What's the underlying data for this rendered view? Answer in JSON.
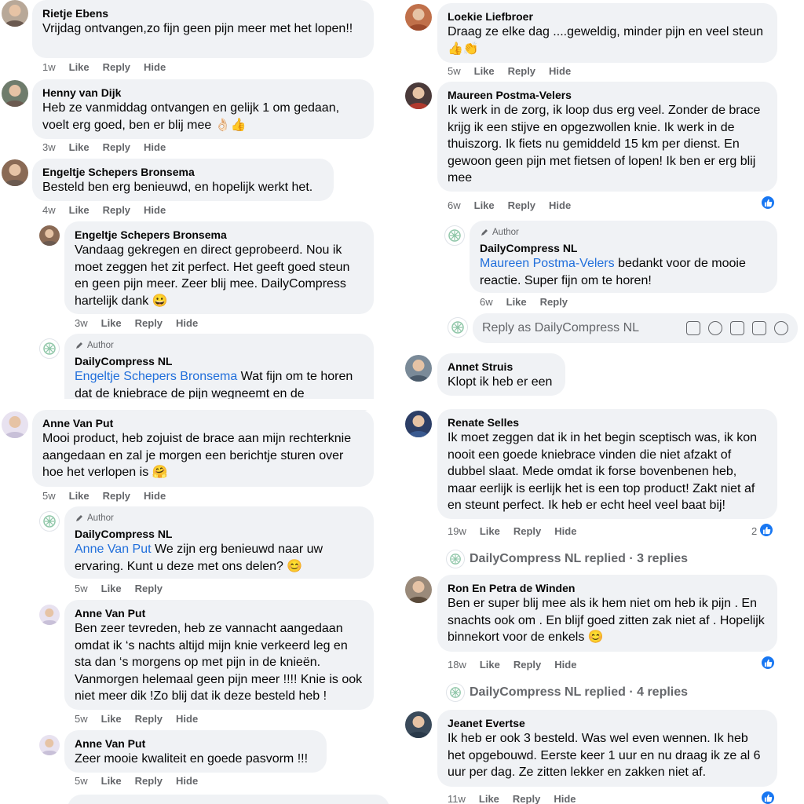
{
  "actions": {
    "like": "Like",
    "reply": "Reply",
    "hide": "Hide"
  },
  "author_label": "Author",
  "left": [
    {
      "id": "c1",
      "name": "Rietje Ebens",
      "text": "Vrijdag ontvangen,zo fijn geen pijn meer met het lopen!!",
      "time": "1w"
    },
    {
      "id": "c2",
      "name": "Henny van Dijk",
      "text": "Heb ze vanmiddag ontvangen en gelijk 1 om gedaan, voelt erg goed, ben er blij mee 👌🏻👍",
      "time": "3w"
    },
    {
      "id": "c3",
      "name": "Engeltje Schepers Bronsema",
      "text": "Besteld ben erg benieuwd, en hopelijk werkt het.",
      "time": "4w"
    },
    {
      "id": "c3r1",
      "name": "Engeltje Schepers Bronsema",
      "text": "Vandaag gekregen en direct geprobeerd. Nou ik moet zeggen het zit perfect. Het geeft goed steun en geen pijn meer. Zeer blij mee. DailyCompress hartelijk dank 😀",
      "time": "3w"
    },
    {
      "id": "c3r2",
      "name": "DailyCompress NL",
      "mention": "Engeltje Schepers Bronsema",
      "text": " Wat fijn om te horen dat de kniebrace de pijn wegneemt en de"
    },
    {
      "id": "c4",
      "name": "Anne Van Put",
      "text": "Mooi product, heb zojuist de brace aan mijn rechterknie aangedaan en zal je morgen een berichtje sturen over hoe het verlopen is 🤗",
      "time": "5w"
    },
    {
      "id": "c4r1",
      "name": "DailyCompress NL",
      "mention": "Anne Van Put",
      "text": " We zijn erg benieuwd naar uw ervaring. Kunt u deze met ons delen? 😊",
      "time": "5w"
    },
    {
      "id": "c4r2",
      "name": "Anne Van Put",
      "text": "Ben zeer tevreden, heb ze vannacht aangedaan omdat ik ‘s nachts altijd mijn knie verkeerd leg en sta dan ‘s morgens op met pijn in de knieën. Vanmorgen helemaal geen pijn meer !!!! Knie is ook niet meer dik !Zo blij dat ik deze besteld heb !",
      "time": "5w"
    },
    {
      "id": "c4r3",
      "name": "Anne Van Put",
      "text": "Zeer mooie kwaliteit en goede pasvorm !!!",
      "time": "5w"
    }
  ],
  "right": [
    {
      "id": "d1",
      "name": "Loekie Liefbroer",
      "text": "Draag ze elke dag ....geweldig, minder pijn en veel steun👍👏",
      "time": "5w"
    },
    {
      "id": "d2",
      "name": "Maureen Postma-Velers",
      "text": "Ik werk in de zorg, ik loop dus erg veel. Zonder de brace krijg ik een stijve en opgezwollen knie. Ik werk in de thuiszorg. Ik fiets nu gemiddeld 15 km per dienst. En gewoon geen pijn met fietsen of lopen! Ik ben er erg blij mee",
      "time": "6w"
    },
    {
      "id": "d2r1",
      "name": "DailyCompress NL",
      "mention": "Maureen Postma-Velers",
      "text": " bedankt voor de mooie reactie. Super fijn om te horen!",
      "time": "6w"
    },
    {
      "id": "d3",
      "name": "Annet Struis",
      "text": "Klopt ik heb er een"
    },
    {
      "id": "d4",
      "name": "Renate Selles",
      "text": "Ik moet zeggen dat ik in het begin sceptisch was, ik kon nooit een goede kniebrace vinden die niet afzakt of dubbel slaat. Mede omdat ik forse bovenbenen heb, maar eerlijk is eerlijk het is een top product! Zakt niet af en steunt perfect. Ik heb er echt heel veel baat bij!",
      "time": "19w",
      "likes": "2"
    },
    {
      "id": "d5",
      "name": "Ron En Petra de Winden",
      "text": "Ben er super blij mee als ik hem niet om heb ik pijn . En snachts ook om . En blijf goed zitten zak niet af . Hopelijk binnekort voor de enkels 😊",
      "time": "18w"
    },
    {
      "id": "d6",
      "name": "Jeanet Evertse",
      "text": "Ik heb er ook 3 besteld. Was wel even wennen. Ik heb het opgebouwd. Eerste keer 1 uur en nu draag ik ze al 6 uur per dag. Ze zitten lekker en zakken niet af.",
      "time": "11w"
    }
  ],
  "reply_box_placeholder": "Reply as DailyCompress NL",
  "replied_1": "DailyCompress NL replied · 3 replies",
  "replied_2": "DailyCompress NL replied · 4 replies",
  "colors": {
    "link": "#216fdb",
    "like_blue": "#1877f2",
    "bubble": "#f0f2f5",
    "meta": "#65676b"
  }
}
